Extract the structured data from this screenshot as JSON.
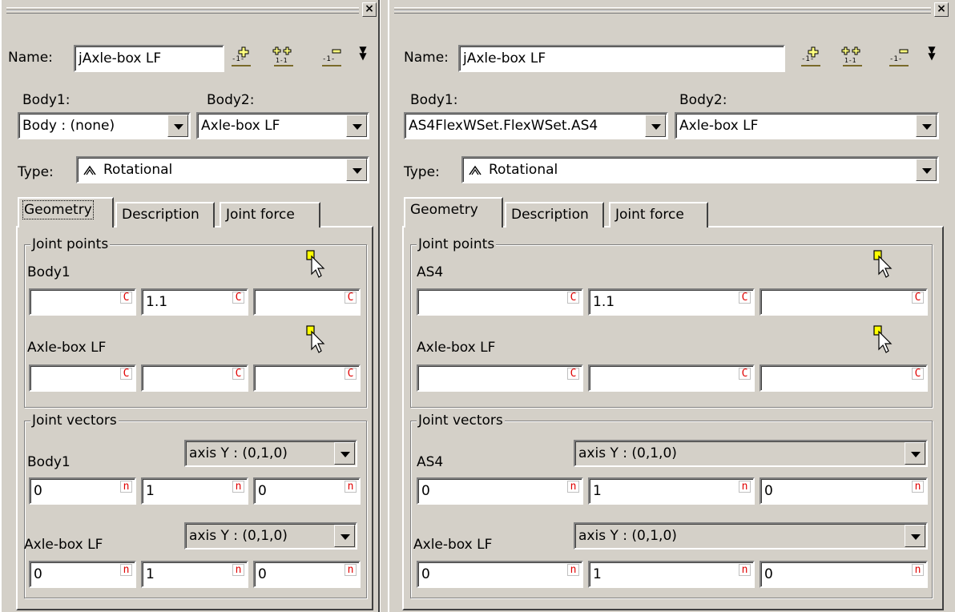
{
  "left": {
    "name_label": "Name:",
    "name_value": "jAxle-box LF",
    "body1_label": "Body1:",
    "body2_label": "Body2:",
    "body1_value": "Body : (none)",
    "body2_value": "Axle-box LF",
    "type_label": "Type:",
    "type_value": "Rotational",
    "tabs": [
      "Geometry",
      "Description",
      "Joint force"
    ],
    "joint_points_title": "Joint points",
    "jp_body1_label": "Body1",
    "jp_body1_values": [
      "",
      "1.1",
      ""
    ],
    "jp_body2_label": "Axle-box LF",
    "jp_body2_values": [
      "",
      "",
      ""
    ],
    "joint_vectors_title": "Joint vectors",
    "jv_body1_label": "Body1",
    "jv_body1_axis": "axis Y : (0,1,0)",
    "jv_body1_values": [
      "0",
      "1",
      "0"
    ],
    "jv_body2_label": "Axle-box LF",
    "jv_body2_axis": "axis Y : (0,1,0)",
    "jv_body2_values": [
      "0",
      "1",
      "0"
    ]
  },
  "right": {
    "name_label": "Name:",
    "name_value": "jAxle-box LF",
    "body1_label": "Body1:",
    "body2_label": "Body2:",
    "body1_value": "AS4FlexWSet.FlexWSet.AS4",
    "body2_value": "Axle-box LF",
    "type_label": "Type:",
    "type_value": "Rotational",
    "tabs": [
      "Geometry",
      "Description",
      "Joint force"
    ],
    "joint_points_title": "Joint points",
    "jp_body1_label": "AS4",
    "jp_body1_values": [
      "",
      "1.1",
      ""
    ],
    "jp_body2_label": "Axle-box LF",
    "jp_body2_values": [
      "",
      "",
      ""
    ],
    "joint_vectors_title": "Joint vectors",
    "jv_body1_label": "AS4",
    "jv_body1_axis": "axis Y : (0,1,0)",
    "jv_body1_values": [
      "0",
      "1",
      "0"
    ],
    "jv_body2_label": "Axle-box LF",
    "jv_body2_axis": "axis Y : (0,1,0)",
    "jv_body2_values": [
      "0",
      "1",
      "0"
    ]
  },
  "field_flags": {
    "point": "C",
    "vector": "n"
  },
  "icons": [
    "add-joint-icon",
    "add-pair-icon",
    "remove-joint-icon",
    "expand-arrows-icon",
    "pick-point-cursor-icon",
    "close-icon"
  ],
  "colors": {
    "background": "#d4d0c8",
    "flag": "#e00000",
    "pick_yellow": "#ffff00"
  }
}
